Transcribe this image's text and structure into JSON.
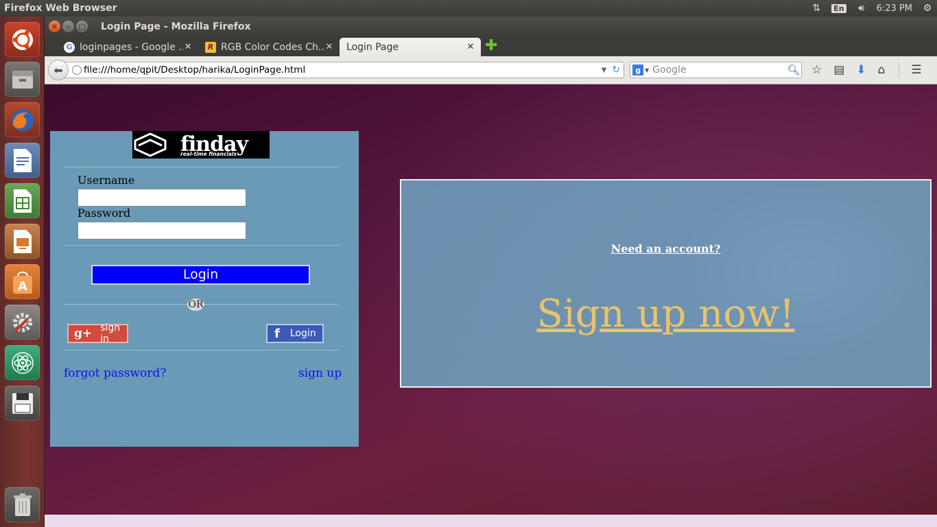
{
  "top_panel": {
    "app_name": "Firefox Web Browser",
    "keyboard_layout": "En",
    "clock": "6:23 PM"
  },
  "launcher": {
    "items": [
      "ubuntu-dash",
      "files",
      "firefox",
      "libreoffice-writer",
      "libreoffice-calc",
      "libreoffice-impress",
      "software-center",
      "system-settings",
      "atom",
      "save-disk",
      "trash"
    ]
  },
  "window": {
    "title": "Login Page - Mozilla Firefox"
  },
  "tabs": [
    {
      "label": "loginpages - Google ...",
      "favicon": "G",
      "close": "✕"
    },
    {
      "label": "RGB Color Codes Ch...",
      "favicon": "R",
      "close": "✕"
    },
    {
      "label": "Login Page",
      "close": "✕"
    }
  ],
  "new_tab": "✚",
  "navbar": {
    "url": "file:///home/qpit/Desktop/harika/LoginPage.html",
    "search_placeholder": "Google"
  },
  "login_form": {
    "logo_text": "finday",
    "logo_subtitle": "real-time financials",
    "username_label": "Username",
    "password_label": "Password",
    "username_value": "",
    "password_value": "",
    "login_button": "Login",
    "or_text": "OR",
    "google_button": "sign in",
    "facebook_button": "Login",
    "forgot_password": "forgot password?",
    "sign_up": "sign up"
  },
  "signup_panel": {
    "need_account": "Need an account?",
    "signup_now": "Sign up now!"
  },
  "colors": {
    "login_box_bg": "#6a9ab5",
    "login_button_bg": "#0000ff",
    "google_red": "#d34a3e",
    "facebook_blue": "#3b5bb6",
    "signup_text": "#e9c46a",
    "link_blue": "#1010ee"
  }
}
